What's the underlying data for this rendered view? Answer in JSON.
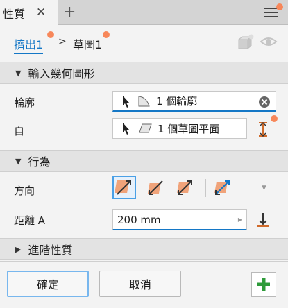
{
  "tab": {
    "title": "性質"
  },
  "breadcrumb": {
    "extrude": "擠出1",
    "sketch": "草圖1"
  },
  "input_geometry": {
    "section_title": "輸入幾何圖形",
    "profile_label": "輪廓",
    "profile_value": "1 個輪廓",
    "from_label": "自",
    "from_value": "1 個草圖平面"
  },
  "behavior": {
    "section_title": "行為",
    "direction_label": "方向",
    "distance_label": "距離 A",
    "distance_value": "200 mm"
  },
  "advanced": {
    "section_title": "進階性質"
  },
  "footer": {
    "ok_label": "確定",
    "cancel_label": "取消"
  },
  "colors": {
    "accent": "#1477c6",
    "notify_dot": "#f7875a",
    "plus_green": "#2e9b3a",
    "direction_orange": "#f0a37a"
  },
  "icons": [
    "close-icon",
    "add-tab-icon",
    "menu-icon",
    "cube-icon",
    "eye-icon",
    "cursor-icon",
    "profile-icon",
    "plane-icon",
    "clear-icon",
    "flip-icon",
    "direction-icon",
    "dropdown-icon",
    "plus-icon"
  ]
}
